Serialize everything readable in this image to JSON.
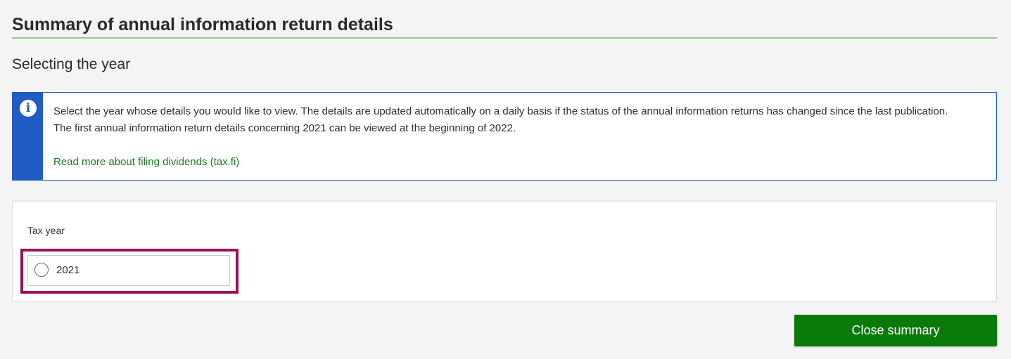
{
  "page": {
    "title": "Summary of annual information return details",
    "section_title": "Selecting the year"
  },
  "info": {
    "icon": "info-icon",
    "glyph": "i",
    "text": "Select the year whose details you would like to view. The details are updated automatically on a daily basis if the status of the annual information returns has changed since the last publication. The first annual information return details concerning 2021 can be viewed at the beginning of 2022.",
    "link_label": "Read more about filing dividends (tax.fi)"
  },
  "form": {
    "field_label": "Tax year",
    "options": [
      {
        "label": "2021",
        "selected": false
      }
    ]
  },
  "actions": {
    "close_label": "Close summary"
  },
  "colors": {
    "accent_green": "#0a7a0a",
    "info_blue": "#215bc4",
    "highlight": "#9b0f5c",
    "link_green": "#1d7a1d"
  }
}
